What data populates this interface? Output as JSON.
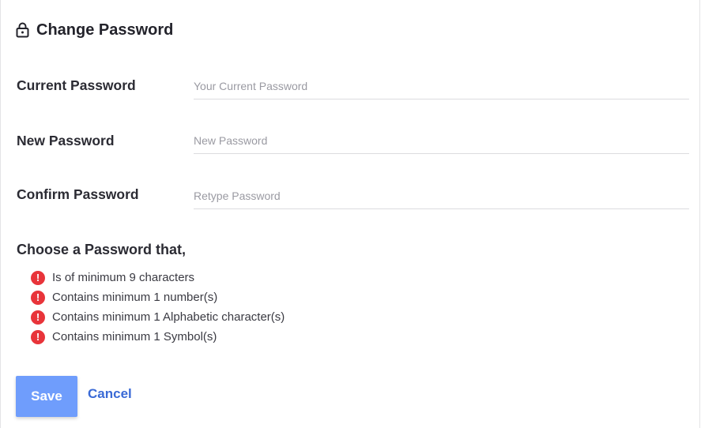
{
  "header": {
    "title": "Change Password",
    "icon": "lock-icon"
  },
  "form": {
    "current": {
      "label": "Current Password",
      "placeholder": "Your Current Password",
      "value": ""
    },
    "new": {
      "label": "New Password",
      "placeholder": "New Password",
      "value": ""
    },
    "confirm": {
      "label": "Confirm Password",
      "placeholder": "Retype Password",
      "value": ""
    }
  },
  "rules": {
    "heading": "Choose a Password that,",
    "icon": "alert-icon",
    "icon_color": "#e8343a",
    "items": [
      "Is of minimum 9 characters",
      "Contains minimum 1 number(s)",
      "Contains minimum 1 Alphabetic character(s)",
      "Contains minimum 1 Symbol(s)"
    ]
  },
  "actions": {
    "save_label": "Save",
    "cancel_label": "Cancel",
    "save_color": "#6f9dfc",
    "cancel_color": "#3a6ad6"
  }
}
